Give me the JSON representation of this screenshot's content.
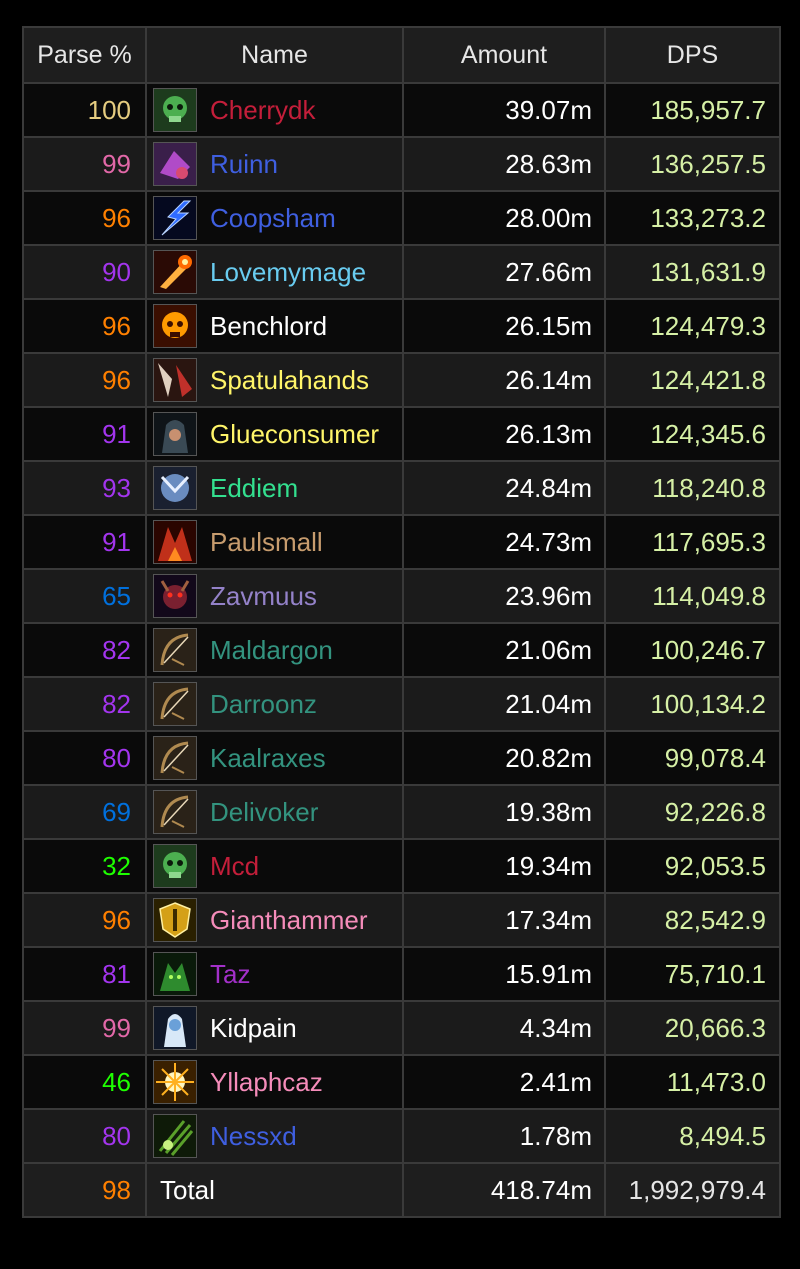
{
  "headers": {
    "parse": "Parse %",
    "name": "Name",
    "amount": "Amount",
    "dps": "DPS"
  },
  "rows": [
    {
      "parse": "100",
      "parse_color": "#e5cc80",
      "name": "Cherrydk",
      "name_color": "#c41e3a",
      "amount": "39.07m",
      "dps": "185,957.7",
      "icon": "death-knight-skull-icon",
      "icon_color": "#4caf50"
    },
    {
      "parse": "99",
      "parse_color": "#e268a8",
      "name": "Ruinn",
      "name_color": "#3f5fe0",
      "amount": "28.63m",
      "dps": "136,257.5",
      "icon": "shaman-enhancement-icon",
      "icon_color": "#b04bc8"
    },
    {
      "parse": "96",
      "parse_color": "#ff8000",
      "name": "Coopsham",
      "name_color": "#3f5fe0",
      "amount": "28.00m",
      "dps": "133,273.2",
      "icon": "lightning-bolt-icon",
      "icon_color": "#2f6bff"
    },
    {
      "parse": "90",
      "parse_color": "#a335ee",
      "name": "Lovemymage",
      "name_color": "#69ccf0",
      "amount": "27.66m",
      "dps": "131,631.9",
      "icon": "fireball-icon",
      "icon_color": "#ff6a00"
    },
    {
      "parse": "96",
      "parse_color": "#ff8000",
      "name": "Benchlord",
      "name_color": "#ffffff",
      "amount": "26.15m",
      "dps": "124,479.3",
      "icon": "flaming-skull-icon",
      "icon_color": "#ff9a00"
    },
    {
      "parse": "96",
      "parse_color": "#ff8000",
      "name": "Spatulahands",
      "name_color": "#fff569",
      "amount": "26.14m",
      "dps": "124,421.8",
      "icon": "rogue-blades-icon",
      "icon_color": "#c0302a"
    },
    {
      "parse": "91",
      "parse_color": "#a335ee",
      "name": "Glueconsumer",
      "name_color": "#fff569",
      "amount": "26.13m",
      "dps": "124,345.6",
      "icon": "hooded-rogue-icon",
      "icon_color": "#3a4a55"
    },
    {
      "parse": "93",
      "parse_color": "#a335ee",
      "name": "Eddiem",
      "name_color": "#33e08f",
      "amount": "24.84m",
      "dps": "118,240.8",
      "icon": "monk-face-icon",
      "icon_color": "#6a8cc0"
    },
    {
      "parse": "91",
      "parse_color": "#a335ee",
      "name": "Paulsmall",
      "name_color": "#c79c6e",
      "amount": "24.73m",
      "dps": "117,695.3",
      "icon": "warrior-fury-icon",
      "icon_color": "#c0301a"
    },
    {
      "parse": "65",
      "parse_color": "#0070dd",
      "name": "Zavmuus",
      "name_color": "#9482c9",
      "amount": "23.96m",
      "dps": "114,049.8",
      "icon": "warlock-demon-icon",
      "icon_color": "#7a2030"
    },
    {
      "parse": "82",
      "parse_color": "#a335ee",
      "name": "Maldargon",
      "name_color": "#33937f",
      "amount": "21.06m",
      "dps": "100,246.7",
      "icon": "evoker-bow-icon",
      "icon_color": "#b08a50"
    },
    {
      "parse": "82",
      "parse_color": "#a335ee",
      "name": "Darroonz",
      "name_color": "#33937f",
      "amount": "21.04m",
      "dps": "100,134.2",
      "icon": "evoker-bow-icon",
      "icon_color": "#b08a50"
    },
    {
      "parse": "80",
      "parse_color": "#a335ee",
      "name": "Kaalraxes",
      "name_color": "#33937f",
      "amount": "20.82m",
      "dps": "99,078.4",
      "icon": "evoker-bow-icon",
      "icon_color": "#b08a50"
    },
    {
      "parse": "69",
      "parse_color": "#0070dd",
      "name": "Delivoker",
      "name_color": "#33937f",
      "amount": "19.38m",
      "dps": "92,226.8",
      "icon": "evoker-bow-icon",
      "icon_color": "#b08a50"
    },
    {
      "parse": "32",
      "parse_color": "#1eff00",
      "name": "Mcd",
      "name_color": "#c41e3a",
      "amount": "19.34m",
      "dps": "92,053.5",
      "icon": "death-knight-skull-icon",
      "icon_color": "#4caf50"
    },
    {
      "parse": "96",
      "parse_color": "#ff8000",
      "name": "Gianthammer",
      "name_color": "#f58cba",
      "amount": "17.34m",
      "dps": "82,542.9",
      "icon": "paladin-shield-icon",
      "icon_color": "#d4a017"
    },
    {
      "parse": "81",
      "parse_color": "#a335ee",
      "name": "Taz",
      "name_color": "#a330c9",
      "amount": "15.91m",
      "dps": "75,710.1",
      "icon": "demon-hunter-icon",
      "icon_color": "#2e8b2e"
    },
    {
      "parse": "99",
      "parse_color": "#e268a8",
      "name": "Kidpain",
      "name_color": "#ffffff",
      "amount": "4.34m",
      "dps": "20,666.3",
      "icon": "shadow-priest-icon",
      "icon_color": "#6aa0d8"
    },
    {
      "parse": "46",
      "parse_color": "#1eff00",
      "name": "Yllaphcaz",
      "name_color": "#f58cba",
      "amount": "2.41m",
      "dps": "11,473.0",
      "icon": "holy-light-icon",
      "icon_color": "#ffb020"
    },
    {
      "parse": "80",
      "parse_color": "#a335ee",
      "name": "Nessxd",
      "name_color": "#3f5fe0",
      "amount": "1.78m",
      "dps": "8,494.5",
      "icon": "shaman-claw-icon",
      "icon_color": "#5aa02a"
    }
  ],
  "total": {
    "parse": "98",
    "parse_color": "#ff8000",
    "name": "Total",
    "amount": "418.74m",
    "dps": "1,992,979.4"
  }
}
